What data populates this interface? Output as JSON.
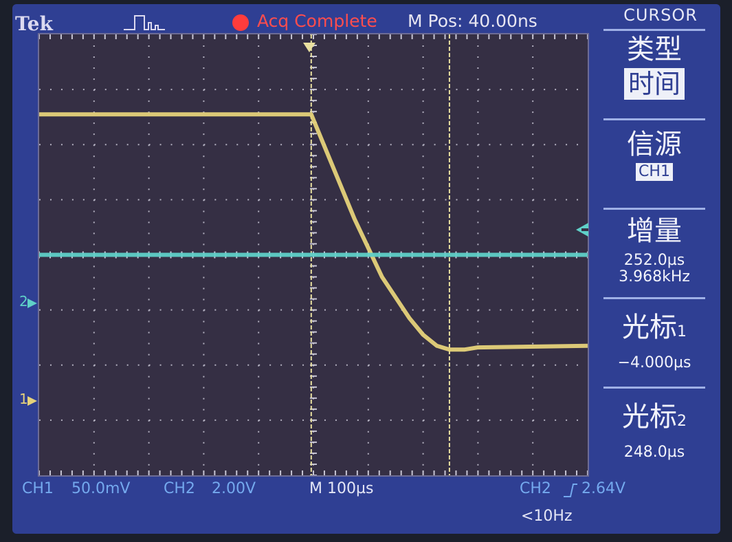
{
  "header": {
    "brand": "Tek",
    "status": "Acq Complete",
    "mpos": "M Pos: 40.00ns"
  },
  "menu": {
    "title": "CURSOR",
    "type_label": "类型",
    "type_value": "时间",
    "source_label": "信源",
    "source_value": "CH1",
    "delta_label": "增量",
    "delta_time": "252.0µs",
    "delta_freq": "3.968kHz",
    "cursor1_label": "光标",
    "cursor1_index": "1",
    "cursor1_value": "−4.000µs",
    "cursor2_label": "光标",
    "cursor2_index": "2",
    "cursor2_value": "248.0µs"
  },
  "footer": {
    "ch1_name": "CH1",
    "ch1_scale": "50.0mV",
    "ch2_name": "CH2",
    "ch2_scale": "2.00V",
    "timebase": "M 100µs",
    "trig_source": "CH2",
    "trig_level": "2.64V",
    "freq_readout": "<10Hz"
  },
  "markers": {
    "ch1": "1",
    "ch2": "2"
  },
  "colors": {
    "ch1": "#e6d27a",
    "ch2": "#5fd0c8",
    "cursor": "#e9e0a0",
    "grid": "#c9c7d6",
    "screen": "#2f3f93",
    "status_dot": "#ff3c3c"
  },
  "icons": {
    "acq_mode": "pulse-waveform-icon",
    "trigger_slope": "rising-edge-icon"
  },
  "chart_data": {
    "type": "line",
    "title": "",
    "xlabel": "",
    "ylabel": "",
    "x_unit": "µs",
    "xlim": [
      -500,
      500
    ],
    "grid": true,
    "series": [
      {
        "name": "CH1",
        "y_unit": "div",
        "x": [
          -500,
          -4,
          25,
          75,
          125,
          175,
          200,
          225,
          248,
          275,
          300,
          500
        ],
        "y": [
          2.55,
          2.55,
          1.85,
          0.65,
          -0.4,
          -1.15,
          -1.45,
          -1.65,
          -1.72,
          -1.72,
          -1.68,
          -1.65
        ]
      },
      {
        "name": "CH2",
        "y_unit": "div",
        "x": [
          -500,
          500
        ],
        "y": [
          0.0,
          0.0
        ]
      }
    ],
    "cursors": [
      -4,
      248
    ]
  }
}
